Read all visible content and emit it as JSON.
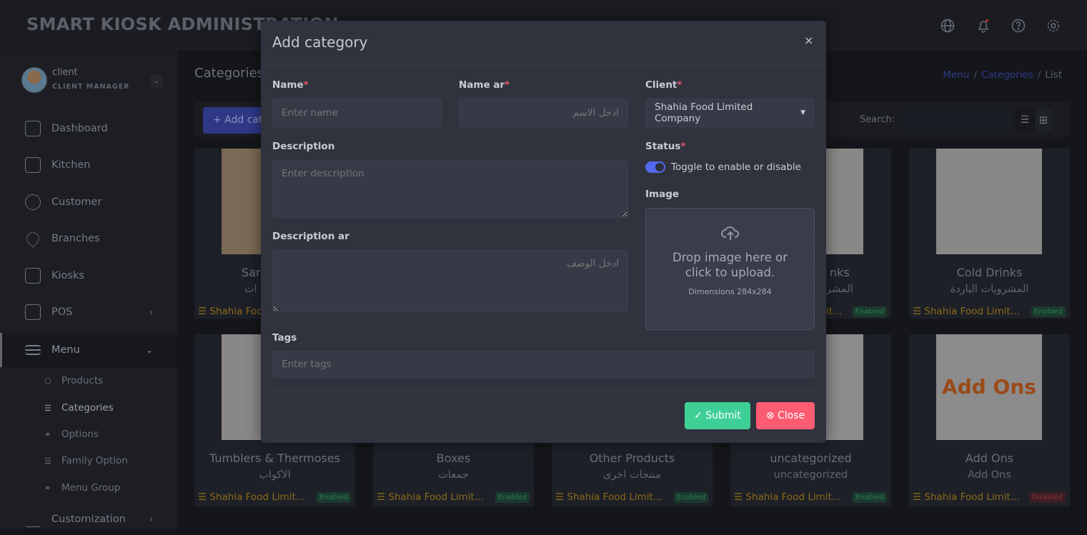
{
  "header": {
    "title": "SMART KIOSK ADMINISTRATION",
    "icons": [
      "globe-icon",
      "bell-icon",
      "help-icon",
      "gear-icon"
    ]
  },
  "user": {
    "name": "client",
    "role": "CLIENT MANAGER"
  },
  "sidebar": {
    "items": [
      {
        "label": "Dashboard",
        "icon": "home-icon"
      },
      {
        "label": "Kitchen",
        "icon": "clipboard-icon"
      },
      {
        "label": "Customer",
        "icon": "users-icon"
      },
      {
        "label": "Branches",
        "icon": "map-pin-icon"
      },
      {
        "label": "Kiosks",
        "icon": "monitor-icon"
      },
      {
        "label": "POS",
        "icon": "monitor-icon"
      },
      {
        "label": "Menu",
        "icon": "menu-icon"
      },
      {
        "label": "Customization",
        "icon": "pen-icon"
      }
    ],
    "sub": [
      {
        "label": "Products"
      },
      {
        "label": "Categories"
      },
      {
        "label": "Options"
      },
      {
        "label": "Family Option"
      },
      {
        "label": "Menu Group"
      }
    ]
  },
  "page": {
    "title": "Categories",
    "breadcrumb": [
      "Menu",
      "Categories",
      "List"
    ],
    "add_label": "+ Add category",
    "search_label": "Search:"
  },
  "cards": [
    {
      "title": "Sar",
      "arabic": "ات",
      "client": "Shahia Food",
      "status": ""
    },
    {
      "title": "nks",
      "arabic": "المشر",
      "client": "it...",
      "status": "Enabled"
    },
    {
      "title": "Cold Drinks",
      "arabic": "المشروبات الباردة",
      "client": "Shahia Food Limit...",
      "status": "Enabled"
    },
    {
      "title": "Tumblers & Thermoses",
      "arabic": "الاكواب",
      "client": "Shahia Food Limit...",
      "status": "Enabled"
    },
    {
      "title": "Boxes",
      "arabic": "جمعات",
      "client": "Shahia Food Limit...",
      "status": "Enabled"
    },
    {
      "title": "Other Products",
      "arabic": "منتجات اخرى",
      "client": "Shahia Food Limit...",
      "status": "Enabled"
    },
    {
      "title": "uncategorized",
      "arabic": "uncategorized",
      "client": "Shahia Food Limit...",
      "status": "Enabled"
    },
    {
      "title": "Add Ons",
      "arabic": "Add Ons",
      "client": "Shahia Food Limit...",
      "status": "Disabled",
      "image_text": "Add Ons"
    }
  ],
  "modal": {
    "title": "Add category",
    "close_icon": "×",
    "name_label": "Name",
    "name_placeholder": "Enter name",
    "name_ar_label": "Name ar",
    "name_ar_placeholder": "ادخل الاسم",
    "client_label": "Client",
    "client_value": "Shahia Food Limited Company",
    "desc_label": "Description",
    "desc_placeholder": "Enter description",
    "desc_ar_label": "Description ar",
    "desc_ar_placeholder": "ادخل الوصف",
    "status_label": "Status",
    "status_toggle": "Toggle to enable or disable",
    "status_enabled": true,
    "image_label": "Image",
    "drop_text": "Drop image here or click to upload.",
    "dimensions": "Dimensions 284x284",
    "tags_label": "Tags",
    "tags_placeholder": "Enter tags",
    "submit": "Submit",
    "close": "Close",
    "required": "*"
  },
  "colors": {
    "accent": "#5468ee",
    "submit": "#3ecf97",
    "close": "#fc5c72",
    "required": "#e5566a"
  }
}
